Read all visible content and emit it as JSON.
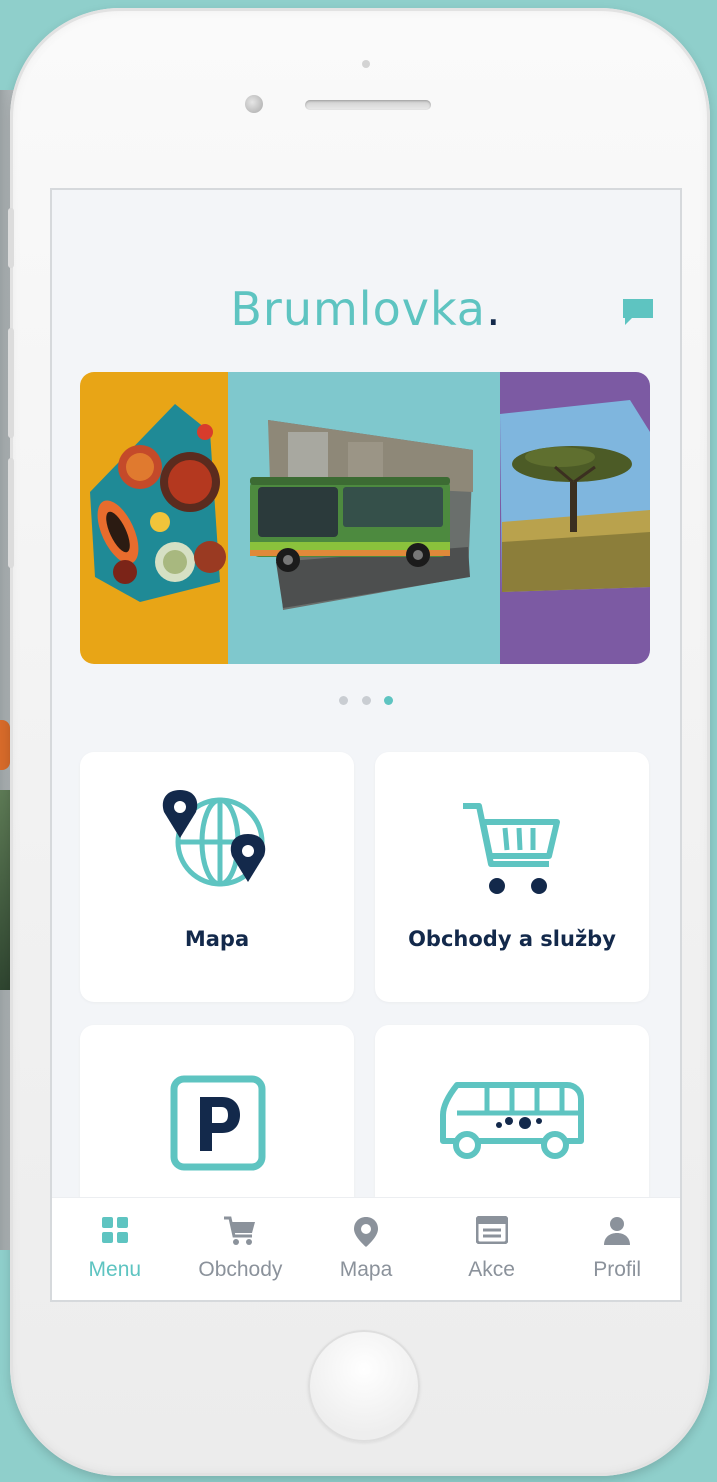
{
  "app": {
    "logo_text": "Brumlovka",
    "logo_dot": "."
  },
  "colors": {
    "accent": "#5ec4c1",
    "navy": "#13294b",
    "tab_inactive": "#8b929b",
    "background": "#8fcfcb"
  },
  "banner": {
    "slides": [
      "food",
      "bus",
      "tree"
    ],
    "active_dot": 3,
    "dot_count": 3
  },
  "tiles": [
    {
      "label": "Mapa",
      "icon": "globe-pins-icon"
    },
    {
      "label": "Obchody a služby",
      "icon": "shopping-cart-icon"
    },
    {
      "label": "",
      "icon": "parking-icon"
    },
    {
      "label": "",
      "icon": "bus-icon"
    }
  ],
  "tabbar": {
    "items": [
      {
        "label": "Menu",
        "icon": "grid-icon",
        "active": true
      },
      {
        "label": "Obchody",
        "icon": "cart-icon",
        "active": false
      },
      {
        "label": "Mapa",
        "icon": "map-pin-icon",
        "active": false
      },
      {
        "label": "Akce",
        "icon": "news-icon",
        "active": false
      },
      {
        "label": "Profil",
        "icon": "user-icon",
        "active": false
      }
    ]
  }
}
